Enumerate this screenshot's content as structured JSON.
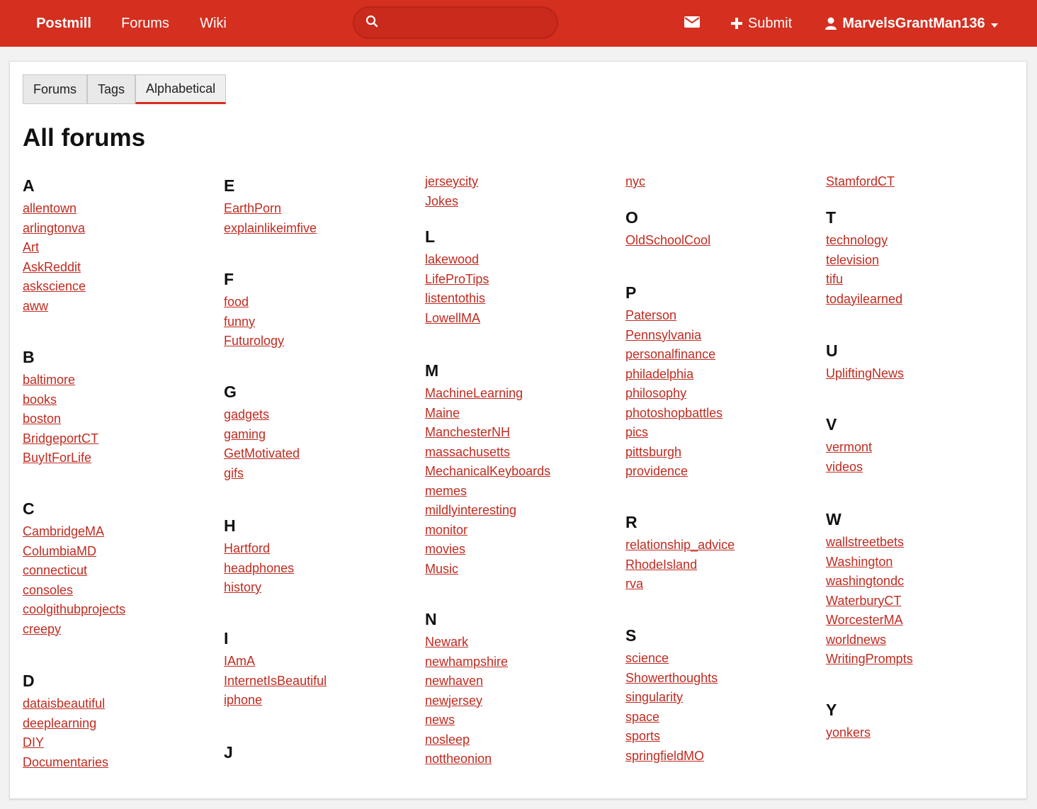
{
  "navbar": {
    "brand": "Postmill",
    "forums": "Forums",
    "wiki": "Wiki",
    "search_placeholder": "",
    "submit": "Submit",
    "user": "MarvelsGrantMan136",
    "accent": "#d42f1f"
  },
  "tabs": [
    {
      "label": "Forums"
    },
    {
      "label": "Tags"
    },
    {
      "label": "Alphabetical"
    }
  ],
  "page_title": "All forums",
  "groups": [
    {
      "letter": "A",
      "forums": [
        "allentown",
        "arlingtonva",
        "Art",
        "AskReddit",
        "askscience",
        "aww"
      ]
    },
    {
      "letter": "B",
      "forums": [
        "baltimore",
        "books",
        "boston",
        "BridgeportCT",
        "BuyItForLife"
      ]
    },
    {
      "letter": "C",
      "forums": [
        "CambridgeMA",
        "ColumbiaMD",
        "connecticut",
        "consoles",
        "coolgithubprojects",
        "creepy"
      ]
    },
    {
      "letter": "D",
      "forums": [
        "dataisbeautiful",
        "deeplearning",
        "DIY",
        "Documentaries"
      ]
    },
    {
      "letter": "E",
      "forums": [
        "EarthPorn",
        "explainlikeimfive"
      ]
    },
    {
      "letter": "F",
      "forums": [
        "food",
        "funny",
        "Futurology"
      ]
    },
    {
      "letter": "G",
      "forums": [
        "gadgets",
        "gaming",
        "GetMotivated",
        "gifs"
      ]
    },
    {
      "letter": "H",
      "forums": [
        "Hartford",
        "headphones",
        "history"
      ]
    },
    {
      "letter": "I",
      "forums": [
        "IAmA",
        "InternetIsBeautiful",
        "iphone"
      ]
    },
    {
      "letter": "J",
      "forums": [
        "jerseycity",
        "Jokes"
      ]
    },
    {
      "letter": "L",
      "forums": [
        "lakewood",
        "LifeProTips",
        "listentothis",
        "LowellMA"
      ]
    },
    {
      "letter": "M",
      "forums": [
        "MachineLearning",
        "Maine",
        "ManchesterNH",
        "massachusetts",
        "MechanicalKeyboards",
        "memes",
        "mildlyinteresting",
        "monitor",
        "movies",
        "Music"
      ]
    },
    {
      "letter": "N",
      "forums": [
        "Newark",
        "newhampshire",
        "newhaven",
        "newjersey",
        "news",
        "nosleep",
        "nottheonion",
        "nyc"
      ]
    },
    {
      "letter": "O",
      "forums": [
        "OldSchoolCool"
      ]
    },
    {
      "letter": "P",
      "forums": [
        "Paterson",
        "Pennsylvania",
        "personalfinance",
        "philadelphia",
        "philosophy",
        "photoshopbattles",
        "pics",
        "pittsburgh",
        "providence"
      ]
    },
    {
      "letter": "R",
      "forums": [
        "relationship_advice",
        "RhodeIsland",
        "rva"
      ]
    },
    {
      "letter": "S",
      "forums": [
        "science",
        "Showerthoughts",
        "singularity",
        "space",
        "sports",
        "springfieldMO",
        "StamfordCT"
      ]
    },
    {
      "letter": "T",
      "forums": [
        "technology",
        "television",
        "tifu",
        "todayilearned"
      ]
    },
    {
      "letter": "U",
      "forums": [
        "UpliftingNews"
      ]
    },
    {
      "letter": "V",
      "forums": [
        "vermont",
        "videos"
      ]
    },
    {
      "letter": "W",
      "forums": [
        "wallstreetbets",
        "Washington",
        "washingtondc",
        "WaterburyCT",
        "WorcesterMA",
        "worldnews",
        "WritingPrompts"
      ]
    },
    {
      "letter": "Y",
      "forums": [
        "yonkers"
      ]
    }
  ]
}
